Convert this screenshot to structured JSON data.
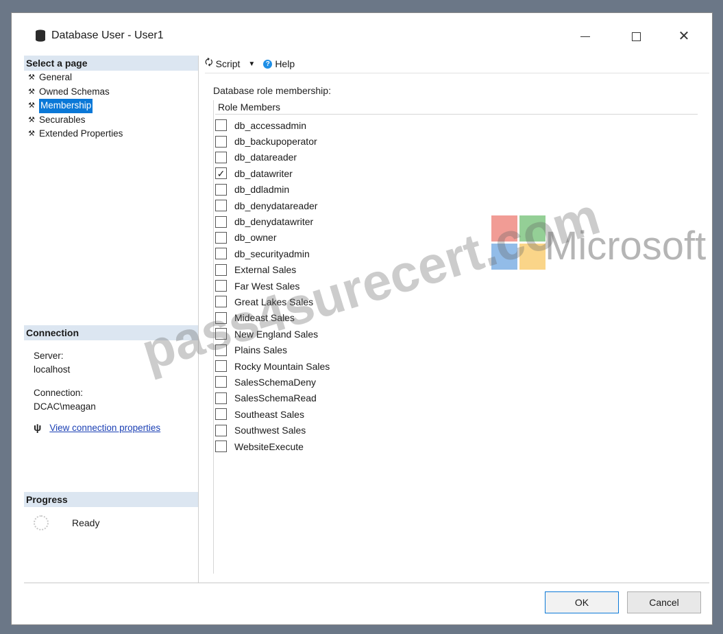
{
  "window": {
    "title": "Database User - User1",
    "controls": {
      "minimize": "—",
      "maximize": "",
      "close": "✕"
    }
  },
  "sidebar": {
    "select_page_header": "Select a page",
    "pages": [
      {
        "label": "General",
        "selected": false
      },
      {
        "label": "Owned Schemas",
        "selected": false
      },
      {
        "label": "Membership",
        "selected": true
      },
      {
        "label": "Securables",
        "selected": false
      },
      {
        "label": "Extended Properties",
        "selected": false
      }
    ],
    "connection_header": "Connection",
    "server_label": "Server:",
    "server_value": "localhost",
    "connection_label": "Connection:",
    "connection_value": "DCAC\\meagan",
    "view_connection_link": "View connection properties",
    "progress_header": "Progress",
    "progress_status": "Ready"
  },
  "toolbar": {
    "script_label": "Script",
    "help_label": "Help"
  },
  "membership": {
    "caption": "Database role membership:",
    "column_header": "Role Members",
    "roles": [
      {
        "name": "db_accessadmin",
        "checked": false
      },
      {
        "name": "db_backupoperator",
        "checked": false
      },
      {
        "name": "db_datareader",
        "checked": false
      },
      {
        "name": "db_datawriter",
        "checked": true
      },
      {
        "name": "db_ddladmin",
        "checked": false
      },
      {
        "name": "db_denydatareader",
        "checked": false
      },
      {
        "name": "db_denydatawriter",
        "checked": false
      },
      {
        "name": "db_owner",
        "checked": false
      },
      {
        "name": "db_securityadmin",
        "checked": false
      },
      {
        "name": "External Sales",
        "checked": false
      },
      {
        "name": "Far West Sales",
        "checked": false
      },
      {
        "name": "Great Lakes Sales",
        "checked": false
      },
      {
        "name": "Mideast Sales",
        "checked": false
      },
      {
        "name": "New England Sales",
        "checked": false
      },
      {
        "name": "Plains Sales",
        "checked": false
      },
      {
        "name": "Rocky Mountain Sales",
        "checked": false
      },
      {
        "name": "SalesSchemaDeny",
        "checked": false
      },
      {
        "name": "SalesSchemaRead",
        "checked": false
      },
      {
        "name": "Southeast Sales",
        "checked": false
      },
      {
        "name": "Southwest Sales",
        "checked": false
      },
      {
        "name": "WebsiteExecute",
        "checked": false
      }
    ]
  },
  "watermark": {
    "brand": "Microsoft",
    "site": "pass4surecert.com"
  },
  "footer": {
    "ok_label": "OK",
    "cancel_label": "Cancel"
  },
  "colors": {
    "selection": "#0a78d7",
    "section_header": "#dce6f1",
    "link": "#1a3fb4"
  }
}
